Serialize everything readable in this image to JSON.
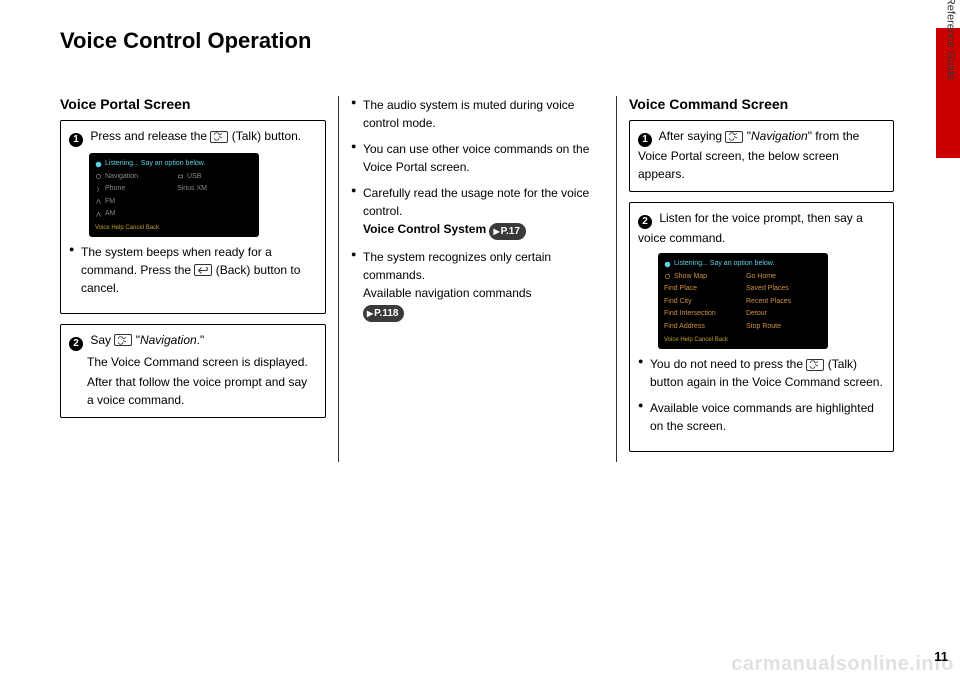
{
  "title": "Voice Control Operation",
  "side_text": "Quick Reference Guide",
  "page_number": "11",
  "watermark": "carmanualsonline.info",
  "col1": {
    "heading": "Voice Portal Screen",
    "box1": {
      "num": "1",
      "line1a": "Press and release the ",
      "line1b": " (Talk) button.",
      "bullet_a": "The system beeps when ready for a command. Press the ",
      "bullet_b": " (Back) button to cancel."
    },
    "box2": {
      "num": "2",
      "line1a": "Say ",
      "line1b": " \"",
      "nav": "Navigation",
      "line1c": ".\"",
      "line2": "The Voice Command screen is displayed.",
      "line3": "After that follow the voice prompt and say a voice command."
    },
    "shot1": {
      "bar": "Listening... Say an option below.",
      "items": [
        "Navigation",
        "USB",
        "Phone",
        "Sirius XM",
        "FM",
        "",
        "AM",
        ""
      ],
      "footer": "Voice Help   Cancel   Back"
    }
  },
  "col2": {
    "bullets": [
      "The audio system is muted during voice control mode.",
      "You can use other voice commands on the Voice Portal screen.",
      "Carefully read the usage note for the voice control.",
      "The system recognizes only certain commands."
    ],
    "ref1_label": "Voice Control System",
    "ref1_page": "P.17",
    "line_avail": "Available navigation commands",
    "ref2_page": "P.118"
  },
  "col3": {
    "heading": "Voice Command Screen",
    "box1": {
      "num": "1",
      "a": "After saying ",
      "b": " \"",
      "nav": "Navigation",
      "c": "\" from the Voice Portal screen, the below screen appears."
    },
    "box2": {
      "num": "2",
      "line": "Listen for the voice prompt, then say a voice command.",
      "bullet1a": "You do not need to press the ",
      "bullet1b": " (Talk) button again in the Voice Command screen.",
      "bullet2": "Available voice commands are highlighted on the screen."
    },
    "shot2": {
      "bar": "Listening... Say an option below.",
      "items": [
        "Show Map",
        "Go Home",
        "Find Place",
        "Saved Places",
        "Find City",
        "Recent Places",
        "Find Intersection",
        "Detour",
        "Find Address",
        "Stop Route"
      ],
      "footer": "Voice Help   Cancel   Back"
    }
  }
}
